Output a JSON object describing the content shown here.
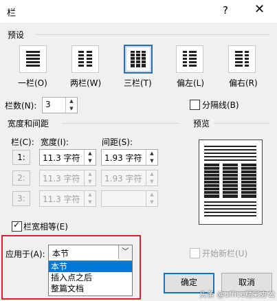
{
  "title": "栏",
  "title_help": "?",
  "title_close": "✕",
  "presets": {
    "heading": "预设",
    "items": [
      {
        "label": "一栏(O)",
        "icon": "one-column-icon",
        "selected": false
      },
      {
        "label": "两栏(W)",
        "icon": "two-columns-icon",
        "selected": false
      },
      {
        "label": "三栏(T)",
        "icon": "three-columns-icon",
        "selected": true
      },
      {
        "label": "偏左(L)",
        "icon": "left-column-icon",
        "selected": false
      },
      {
        "label": "偏右(R)",
        "icon": "right-column-icon",
        "selected": false
      }
    ]
  },
  "columns_count": {
    "label": "栏数(N):",
    "value": "3"
  },
  "separator_line": {
    "label": "分隔线(B)",
    "checked": false
  },
  "width_spacing": {
    "heading": "宽度和间距",
    "col_header": "栏(C):",
    "width_header": "宽度(I):",
    "spacing_header": "间距(S):",
    "rows": [
      {
        "num": "1:",
        "width": "11.3 字符",
        "spacing": "1.93 字符",
        "enabled": true
      },
      {
        "num": "2:",
        "width": "11.3 字符",
        "spacing": "1.93 字符",
        "enabled": false
      },
      {
        "num": "3:",
        "width": "11.3 字符",
        "spacing": "",
        "enabled": false
      }
    ]
  },
  "equal_width": {
    "label": "栏宽相等(E)",
    "checked": true
  },
  "preview": {
    "heading": "预览"
  },
  "apply_to": {
    "label": "应用于(A):",
    "value": "本节",
    "options": [
      "本节",
      "插入点之后",
      "整篇文档"
    ],
    "selected_index": 0
  },
  "new_column": {
    "label": "开始新栏(U)",
    "checked": false
  },
  "buttons": {
    "ok": "确定",
    "cancel": "取消"
  },
  "watermark": "头条 @office精彩办公",
  "colors": {
    "accent": "#0078d7",
    "highlight_box": "#d9202c"
  }
}
